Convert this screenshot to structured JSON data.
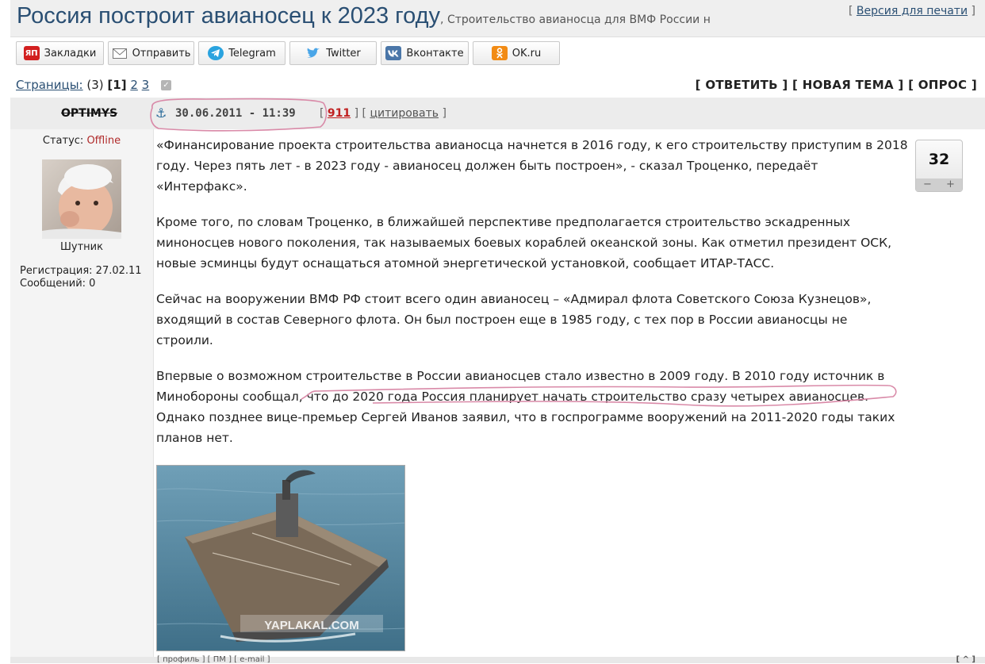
{
  "topic": {
    "title": "Россия построит авианосец к 2023 году",
    "subtitle": ", Строительство авианосца для ВМФ России н",
    "print_link": "Версия для печати",
    "bracket_open": "[",
    "bracket_close": "]"
  },
  "share_buttons": [
    {
      "label": "Закладки",
      "icon": "yap-icon",
      "icon_text": "ЯП"
    },
    {
      "label": "Отправить",
      "icon": "mail-icon"
    },
    {
      "label": "Telegram",
      "icon": "telegram-icon"
    },
    {
      "label": "Twitter",
      "icon": "twitter-icon"
    },
    {
      "label": "Вконтакте",
      "icon": "vk-icon"
    },
    {
      "label": "OK.ru",
      "icon": "ok-icon"
    }
  ],
  "pagination": {
    "label": "Страницы:",
    "count": "(3)",
    "current": "[1]",
    "page2": "2",
    "page3": "3"
  },
  "actions": {
    "reply": "[ ОТВЕТИТЬ ]",
    "new_topic": "[ НОВАЯ ТЕМА ]",
    "poll": "[ ОПРОС ]"
  },
  "post": {
    "author": "OPTIMYS",
    "datetime": "30.06.2011 - 11:39",
    "post_number": "911",
    "quote_label": "цитировать",
    "rating": "32",
    "rating_minus": "−",
    "rating_plus": "+",
    "paragraphs": [
      "«Финансирование проекта строительства авианосца начнется в 2016 году, к его строительству приступим в 2018 году. Через пять лет - в 2023 году - авианосец должен быть построен», - сказал Троценко, передаёт «Интерфакс».",
      "Кроме того, по словам Троценко, в ближайшей перспективе предполагается строительство эскадренных миноносцев нового поколения, так называемых боевых кораблей океанской зоны. Как отметил президент ОСК, новые эсминцы будут оснащаться атомной энергетической установкой, сообщает ИТАР-ТАСС.",
      "Сейчас на вооружении ВМФ РФ стоит всего один авианосец – «Адмирал флота Советского Союза Кузнецов», входящий в состав Северного флота. Он был построен еще в 1985 году, с тех пор в России авианосцы не строили.",
      "Впервые о возможном строительстве в России авианосцев стало известно в 2009 году. В 2010 году источник в Минобороны сообщал, что до 2020 года Россия планирует начать строительство сразу четырех авианосцев. Однако позднее вице-премьер Сергей Иванов заявил, что в госпрограмме вооружений на 2011-2020 годы таких планов нет."
    ],
    "image_watermark": "YAPLAKAL.COM"
  },
  "user": {
    "status_label": "Статус:",
    "status_value": "Offline",
    "title": "Шутник",
    "registration": "Регистрация: 27.02.11",
    "messages": "Сообщений: 0"
  },
  "footer": {
    "left_links": "[ профиль ] [ ПМ ] [ e-mail ]",
    "top_link": "[ ^ ]"
  },
  "colors": {
    "title": "#2a4f73",
    "offline": "#b02a2a",
    "post_number": "#c02020",
    "annotation": "#d98aa8"
  }
}
